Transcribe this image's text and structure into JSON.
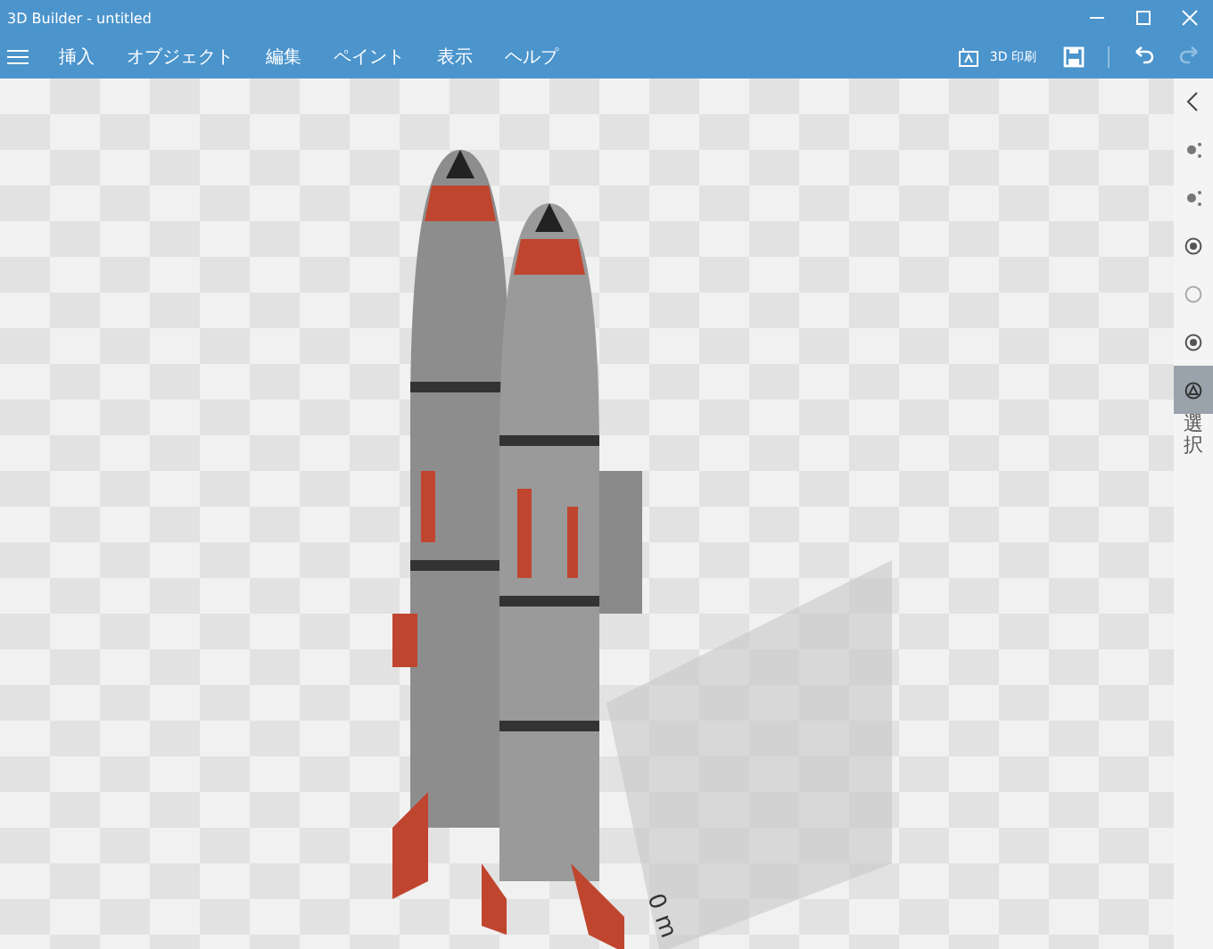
{
  "window": {
    "title": "3D Builder - untitled"
  },
  "menu": {
    "items": [
      {
        "label": "挿入"
      },
      {
        "label": "オブジェクト"
      },
      {
        "label": "編集"
      },
      {
        "label": "ペイント"
      },
      {
        "label": "表示"
      },
      {
        "label": "ヘルプ"
      }
    ],
    "print_label": "3D 印刷",
    "redo_disabled": true
  },
  "viewport": {
    "scale_label": "0 m"
  },
  "sidebar": {
    "tools": [
      {
        "kind": "sparkle",
        "selected": false
      },
      {
        "kind": "sparkle",
        "selected": false
      },
      {
        "kind": "circle-badge",
        "selected": false
      },
      {
        "kind": "circle",
        "selected": false
      },
      {
        "kind": "circle-badge",
        "selected": false
      },
      {
        "kind": "triangle-circle",
        "selected": true,
        "label": "選択"
      }
    ]
  }
}
